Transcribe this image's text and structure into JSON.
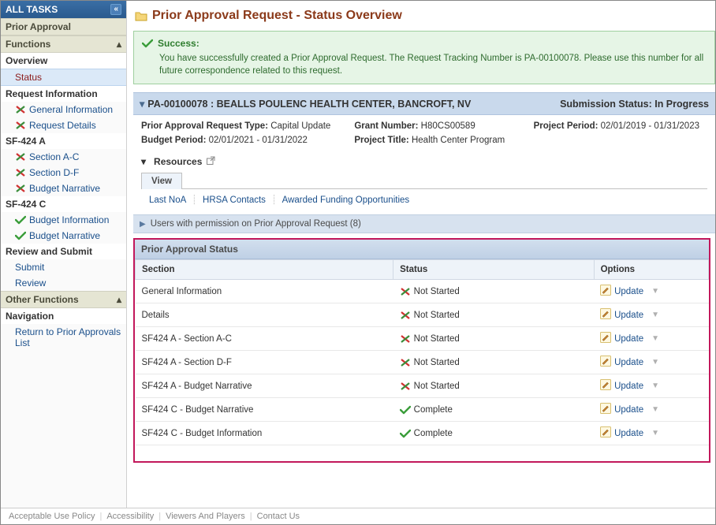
{
  "sidebar": {
    "title": "ALL TASKS",
    "groups": [
      {
        "label": "Prior Approval"
      },
      {
        "label": "Functions"
      }
    ],
    "overview": {
      "label": "Overview",
      "status": "Status"
    },
    "reqinfo": {
      "label": "Request Information",
      "items": [
        "General Information",
        "Request Details"
      ]
    },
    "sf424a": {
      "label": "SF-424 A",
      "items": [
        "Section A-C",
        "Section D-F",
        "Budget Narrative"
      ]
    },
    "sf424c": {
      "label": "SF-424 C",
      "items": [
        "Budget Information",
        "Budget Narrative"
      ]
    },
    "review": {
      "label": "Review and Submit",
      "items": [
        "Submit",
        "Review"
      ]
    },
    "other": {
      "label": "Other Functions"
    },
    "nav": {
      "label": "Navigation",
      "items": [
        "Return to Prior Approvals List"
      ]
    }
  },
  "page": {
    "title": "Prior Approval Request - Status Overview"
  },
  "success": {
    "heading": "Success:",
    "message": "You have successfully created a Prior Approval Request. The Request Tracking Number is PA-00100078. Please use this number for all future correspondence related to this request."
  },
  "record": {
    "header": "PA-00100078 : BEALLS POULENC HEALTH CENTER, BANCROFT, NV",
    "submission_label": "Submission Status: In Progress",
    "type_label": "Prior Approval Request Type:",
    "type_value": "Capital Update",
    "budget_label": "Budget Period:",
    "budget_value": "02/01/2021 - 01/31/2022",
    "grant_label": "Grant Number:",
    "grant_value": "H80CS00589",
    "projtitle_label": "Project Title:",
    "projtitle_value": "Health Center Program",
    "projperiod_label": "Project Period:",
    "projperiod_value": "02/01/2019 - 01/31/2023"
  },
  "resources": {
    "label": "Resources",
    "tab": "View",
    "links": [
      "Last NoA",
      "HRSA Contacts",
      "Awarded Funding Opportunities"
    ]
  },
  "perm_panel": "Users with permission on Prior Approval Request (8)",
  "status_table": {
    "title": "Prior Approval Status",
    "cols": [
      "Section",
      "Status",
      "Options"
    ],
    "option_label": "Update",
    "rows": [
      {
        "section": "General Information",
        "status": "Not Started",
        "complete": false
      },
      {
        "section": "Details",
        "status": "Not Started",
        "complete": false
      },
      {
        "section": "SF424 A - Section A-C",
        "status": "Not Started",
        "complete": false
      },
      {
        "section": "SF424 A - Section D-F",
        "status": "Not Started",
        "complete": false
      },
      {
        "section": "SF424 A - Budget Narrative",
        "status": "Not Started",
        "complete": false
      },
      {
        "section": "SF424 C - Budget Narrative",
        "status": "Complete",
        "complete": true
      },
      {
        "section": "SF424 C - Budget Information",
        "status": "Complete",
        "complete": true
      }
    ]
  },
  "footer": {
    "links": [
      "Acceptable Use Policy",
      "Accessibility",
      "Viewers And Players",
      "Contact Us"
    ]
  },
  "svg_x_icon": "<svg viewBox='0 0 14 12'><path d='M2 2 L12 10' stroke='#d03030' stroke-width='2.2' fill='none'/><path d='M12 2 L2 10' stroke='#3a8d3a' stroke-width='2.2' fill='none'/></svg>",
  "svg_check_icon": "<svg viewBox='0 0 14 12'><path d='M1 6 L5 10 L13 2' stroke='#3a9d3a' stroke-width='2.4' fill='none' stroke-linecap='round' stroke-linejoin='round'/></svg>",
  "svg_pencil_icon": "<svg viewBox='0 0 14 14'><rect x='0.5' y='0.5' width='13' height='13' rx='1' fill='#fff8e0' stroke='#d8c070'/><path d='M3 10 L9 4 L10.5 5.5 L4.5 11.5 Z' fill='#c08030' stroke='#8a5a20' stroke-width='0.5'/></svg>",
  "svg_folder_icon": "<svg viewBox='0 0 16 14'><path d='M1 3 h5 l1.5 2 h7.5 v8 h-14 z' fill='#f5d67a' stroke='#c9a227'/><path d='M1 3 h5 l1 1.3 h-6 z' fill='#e8c45a'/></svg>",
  "svg_ext_icon": "<svg viewBox='0 0 11 11'><rect x='0.5' y='3' width='7.5' height='7.5' fill='none' stroke='#888'/><path d='M5 1 h5 v5' fill='none' stroke='#888'/><path d='M10 1 L5 6' stroke='#888'/></svg>"
}
